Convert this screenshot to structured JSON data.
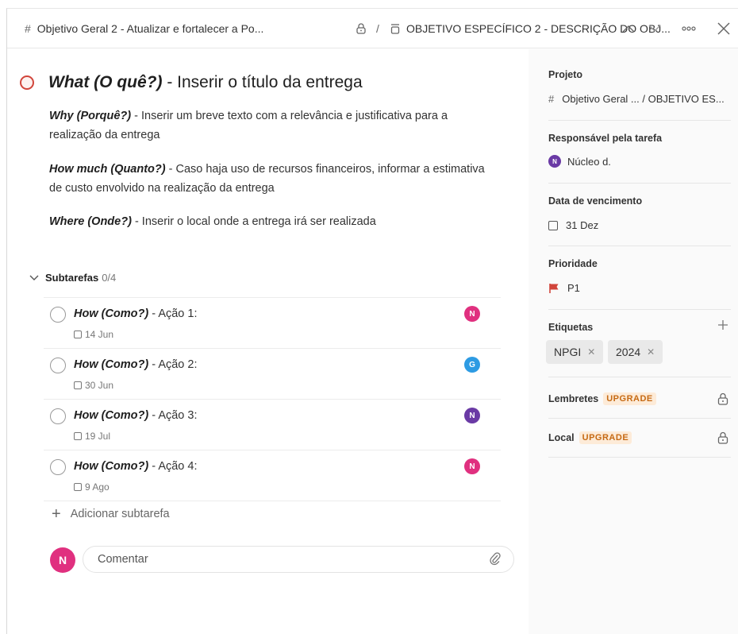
{
  "breadcrumb": {
    "project_icon": "#",
    "project": "Objetivo Geral 2 - Atualizar e fortalecer a Po...",
    "separator": "/",
    "section": "OBJETIVO ESPECÍFICO 2 - DESCRIÇÃO DO OBJ..."
  },
  "task": {
    "title_bold": "What (O quê?)",
    "title_rest": " - Inserir o título da entrega",
    "description": [
      {
        "bold": "Why (Porquê?)",
        "text": " - Inserir um breve texto com a relevância e justificativa para a",
        "line2": "realização da entrega"
      },
      {
        "bold": "How much (Quanto?)",
        "text": " - Caso haja uso de recursos financeiros, informar a estimativa",
        "line2": "de custo envolvido na realização da entrega"
      },
      {
        "bold": "Where (Onde?)",
        "text": " - Inserir o local onde a entrega irá ser realizada",
        "line2": ""
      }
    ]
  },
  "subtasks": {
    "label": "Subtarefas",
    "count": "0/4",
    "items": [
      {
        "bold": "How (Como?)",
        "text": " - Ação 1:",
        "date": "14 Jun",
        "avatar": "N",
        "avatar_color": "#e0307f"
      },
      {
        "bold": "How (Como?)",
        "text": " - Ação 2:",
        "date": "30 Jun",
        "avatar": "G",
        "avatar_color": "#2d9be3"
      },
      {
        "bold": "How (Como?)",
        "text": " - Ação 3:",
        "date": "19 Jul",
        "avatar": "N",
        "avatar_color": "#6a3aa5"
      },
      {
        "bold": "How (Como?)",
        "text": " - Ação 4:",
        "date": "9 Ago",
        "avatar": "N",
        "avatar_color": "#e0307f"
      }
    ],
    "add_label": "Adicionar subtarefa"
  },
  "comment": {
    "avatar": "N",
    "placeholder": "Comentar"
  },
  "sidebar": {
    "project_label": "Projeto",
    "project_value": "Objetivo Geral ...  / OBJETIVO ES...",
    "assignee_label": "Responsável pela tarefa",
    "assignee_avatar": "N",
    "assignee_name": "Núcleo d.",
    "due_label": "Data de vencimento",
    "due_value": "31 Dez",
    "priority_label": "Prioridade",
    "priority_value": "P1",
    "labels_label": "Etiquetas",
    "labels": [
      "NPGI",
      "2024"
    ],
    "reminders_label": "Lembretes",
    "location_label": "Local",
    "upgrade": "UPGRADE"
  },
  "colors": {
    "accent_red": "#d1453b",
    "upgrade_bg": "#fdebd8",
    "upgrade_text": "#c66a14"
  }
}
